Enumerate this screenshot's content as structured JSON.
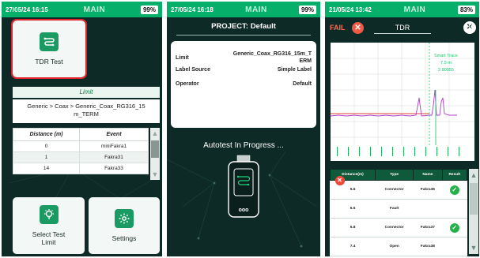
{
  "panel1": {
    "status": {
      "time": "27/05/24 16:15",
      "title": "MAIN",
      "battery": "99%"
    },
    "tdr_tile": {
      "label": "TDR Test",
      "icon": "tdr-cable-icon"
    },
    "limit": {
      "header": "Limit",
      "value_line1": "Generic > Coax > Generic_Coax_RG316_15",
      "value_line2": "m_TERM"
    },
    "events": {
      "headers": [
        "Distance (m)",
        "Event"
      ],
      "rows": [
        {
          "distance": "0",
          "event": "miniFakra1"
        },
        {
          "distance": "1",
          "event": "Fakra31"
        },
        {
          "distance": "14",
          "event": "Fakra33"
        }
      ]
    },
    "select_limit": {
      "label": "Select Test Limit",
      "icon": "lightbulb-icon"
    },
    "settings": {
      "label": "Settings",
      "icon": "gear-icon"
    }
  },
  "panel2": {
    "status": {
      "time": "27/05/24 16:18",
      "title": "MAIN",
      "battery": "99%"
    },
    "project_title": "PROJECT: Default",
    "details": [
      {
        "key": "Limit",
        "value": "Generic_Coax_RG316_15m_TERM"
      },
      {
        "key": "Label Source",
        "value": "Simple Label"
      },
      {
        "key": "Operator",
        "value": "Default"
      }
    ],
    "progress_text": "Autotest In Progress ...",
    "device_label": "ooo"
  },
  "panel3": {
    "status": {
      "time": "21/05/24 13:42",
      "title": "MAIN",
      "battery": "83%"
    },
    "fail_label": "FAIL",
    "title": "TDR",
    "unit": "Ω",
    "annotation": {
      "label": "Smart Trace",
      "distance": "7.5 m",
      "value": "2.90955"
    },
    "table": {
      "headers": [
        "Distance(m)",
        "Type",
        "Name",
        "Result"
      ],
      "rows": [
        {
          "distance": "5.6",
          "type": "Connector",
          "name": "Fakra36",
          "result": "pass"
        },
        {
          "distance": "6.5",
          "type": "Fault",
          "name": "",
          "result": "fail"
        },
        {
          "distance": "6.8",
          "type": "Connector",
          "name": "Fakra37",
          "result": "pass"
        },
        {
          "distance": "7.4",
          "type": "Open",
          "name": "Fakra38",
          "result": "fail"
        }
      ]
    },
    "colors": {
      "accent": "#06b06a",
      "fail": "#ee4a3a",
      "pass": "#25b24a",
      "trace": "#b03cc8",
      "reference": "#e0442e"
    }
  }
}
